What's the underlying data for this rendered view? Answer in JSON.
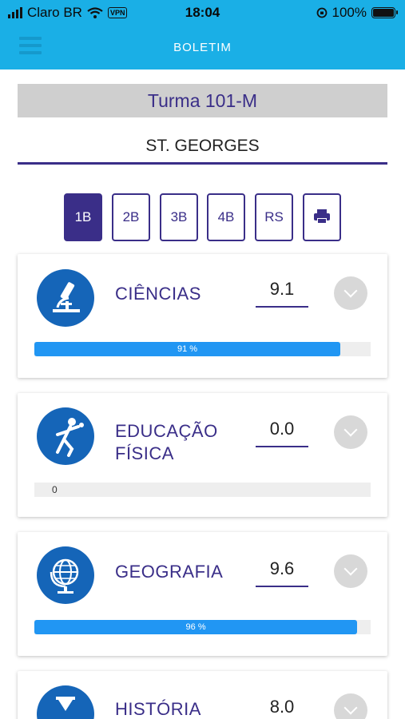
{
  "status": {
    "carrier": "Claro BR",
    "vpn": "VPN",
    "time": "18:04",
    "battery": "100%"
  },
  "header": {
    "title": "BOLETIM"
  },
  "turma": "Turma 101-M",
  "school": "ST. GEORGES",
  "tabs": [
    {
      "label": "1B",
      "active": true
    },
    {
      "label": "2B",
      "active": false
    },
    {
      "label": "3B",
      "active": false
    },
    {
      "label": "4B",
      "active": false
    },
    {
      "label": "RS",
      "active": false
    }
  ],
  "subjects": [
    {
      "name": "CIÊNCIAS",
      "grade": "9.1",
      "progress": 0.91,
      "progress_label": "91 %",
      "icon": "microscope-icon"
    },
    {
      "name_line1": "EDUCAÇÃO",
      "name_line2": "FÍSICA",
      "grade": "0.0",
      "progress": 0,
      "progress_label": "0",
      "icon": "discus-thrower-icon"
    },
    {
      "name": "GEOGRAFIA",
      "grade": "9.6",
      "progress": 0.96,
      "progress_label": "96 %",
      "icon": "globe-icon"
    },
    {
      "name": "HISTÓRIA",
      "grade": "8.0",
      "icon": "hourglass-icon"
    }
  ],
  "colors": {
    "appbar": "#1aafe6",
    "accent": "#3a2e88",
    "progress": "#2196f3",
    "icon_bg": "#1565b8"
  }
}
